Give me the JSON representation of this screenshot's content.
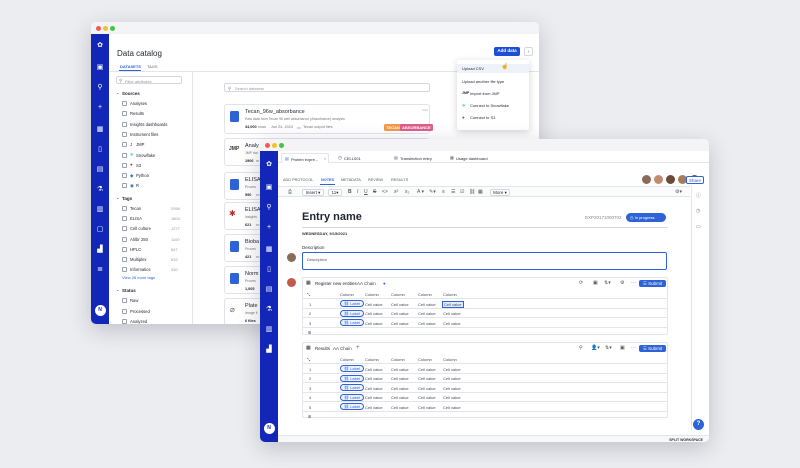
{
  "catalog": {
    "title": "Data catalog",
    "tabs": [
      "DATASETS",
      "TAGS"
    ],
    "add_button": "Add data",
    "filter_placeholder": "Filter attributes",
    "search_placeholder": "Search datasets",
    "sources_header": "Sources",
    "sources": [
      "Analyses",
      "Results",
      "Insights dashboards",
      "Instrument files",
      "JMP",
      "Snowflake",
      "S3",
      "Python",
      "R"
    ],
    "tags_header": "Tags",
    "tags": [
      {
        "name": "Tecan",
        "count": "2958"
      },
      {
        "name": "ELISA",
        "count": "1804"
      },
      {
        "name": "Cell culture",
        "count": "1277"
      },
      {
        "name": "Ahlbr 250",
        "count": "1100"
      },
      {
        "name": "HPLC",
        "count": "847"
      },
      {
        "name": "Multiplex",
        "count": "632"
      },
      {
        "name": "Informatics",
        "count": "330"
      }
    ],
    "view_more_tags": "View 28 more tags",
    "status_header": "Status",
    "statuses": [
      "Raw",
      "Processed",
      "Analyzed"
    ],
    "dropdown": [
      "Upload CSV",
      "Upload another file type",
      "Import from JMP",
      "Connect to Snowflake",
      "Connect to S3"
    ],
    "cards": [
      {
        "title": "Tecan_96w_absorbance",
        "desc": "Raw data from Tecan 96 well absorbance (Absorbance) analysis",
        "rows": "34,000",
        "rows_unit": "rows",
        "date": "Jun 24, 2023",
        "source": "Tecan output files",
        "tags": [
          "TECAN",
          "ABSORBANCE"
        ]
      },
      {
        "title": "Analy",
        "desc": "JMP dat",
        "rows": "1906",
        "rows_unit": "m"
      },
      {
        "title": "ELISA",
        "desc": "Proces",
        "rows": "590",
        "rows_unit": "ro"
      },
      {
        "title": "ELISA",
        "desc": "Insights",
        "rows": "621",
        "rows_unit": "ro"
      },
      {
        "title": "Bioba",
        "desc": "Proces",
        "rows": "421",
        "rows_unit": "ro"
      },
      {
        "title": "Norm",
        "desc": "Proces",
        "rows": "1,005",
        "rows_unit": ""
      },
      {
        "title": "Plate",
        "desc": "Image fi",
        "rows": "6 files",
        "rows_unit": ""
      }
    ]
  },
  "notebook": {
    "doc_tabs": [
      "Protein expre...",
      "CELL001",
      "Transfection entry",
      "Usage dashboard"
    ],
    "sub_tabs": [
      "ADD PROTOCOL",
      "NOTES",
      "METADATA",
      "REVIEW",
      "RESULTS"
    ],
    "share": "Share",
    "toolbar": {
      "insert": "Insert",
      "size": "11",
      "more": "More"
    },
    "entry_title": "Entry name",
    "entry_id": "EXP20171000702",
    "status": "In progress",
    "date": "WEDNESDAY, 9/15/2021",
    "description_label": "Description",
    "description_value": "Description",
    "register_table": {
      "title": "Register new entities",
      "chain": "AA Chain",
      "submit": "Submit",
      "headers": [
        "Column",
        "Column",
        "Column",
        "Column",
        "Column"
      ],
      "rows": [
        [
          "1",
          "Label",
          "Cell value",
          "Cell value",
          "Cell value",
          "Cell value"
        ],
        [
          "2",
          "Label",
          "Cell value",
          "Cell value",
          "Cell value",
          "Cell value"
        ],
        [
          "3",
          "Label",
          "Cell value",
          "Cell value",
          "Cell value",
          "Cell value"
        ]
      ]
    },
    "results_table": {
      "title": "Results",
      "chain": "AA Chain",
      "submit": "Submit",
      "headers": [
        "Column",
        "Column",
        "Column",
        "Column",
        "Column"
      ],
      "rows": [
        [
          "1",
          "Label",
          "Cell value",
          "Cell value",
          "Cell value",
          "Cell value"
        ],
        [
          "2",
          "Label",
          "Cell value",
          "Cell value",
          "Cell value",
          "Cell value"
        ],
        [
          "3",
          "Label",
          "Cell value",
          "Cell value",
          "Cell value",
          "Cell value"
        ],
        [
          "4",
          "Label",
          "Cell value",
          "Cell value",
          "Cell value",
          "Cell value"
        ],
        [
          "5",
          "Label",
          "Cell value",
          "Cell value",
          "Cell value",
          "Cell value"
        ]
      ]
    },
    "split_workspace": "SPLIT WORKSPACE",
    "help": "?"
  },
  "colors": {
    "accent": "#1227b8",
    "link": "#2e63d8",
    "tag_orange": "#f2994a",
    "tag_pink": "#e05d8b"
  }
}
